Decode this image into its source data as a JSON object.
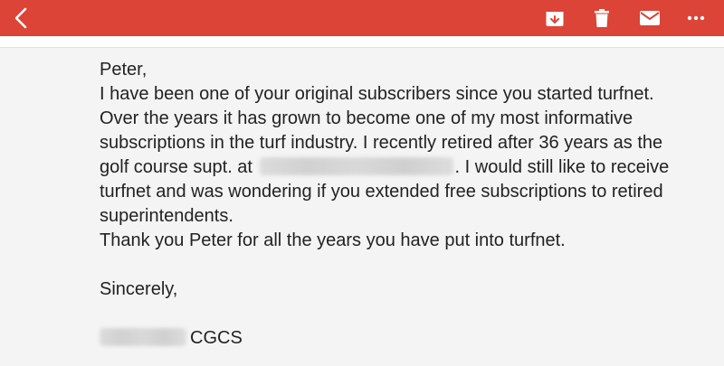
{
  "toolbar": {
    "background_color": "#db4437",
    "icons": [
      "back-icon",
      "archive-icon",
      "trash-icon",
      "mail-icon",
      "more-icon"
    ]
  },
  "email": {
    "greeting": "Peter,",
    "lines": [
      "I have been one of your original subscribers since you started turfnet.",
      "Over the years it has grown to become one of my most informative",
      "subscriptions in the turf industry. I recently retired after 36 years as the"
    ],
    "line4_prefix": "golf course supt. at",
    "line4_suffix": ". I would still like to receive",
    "lines_after": [
      "turfnet and was wondering if you extended free subscriptions to retired",
      "superintendents.",
      "Thank you Peter for all the years you have put into turfnet."
    ],
    "closing": "Sincerely,",
    "signature_suffix": "CGCS"
  }
}
